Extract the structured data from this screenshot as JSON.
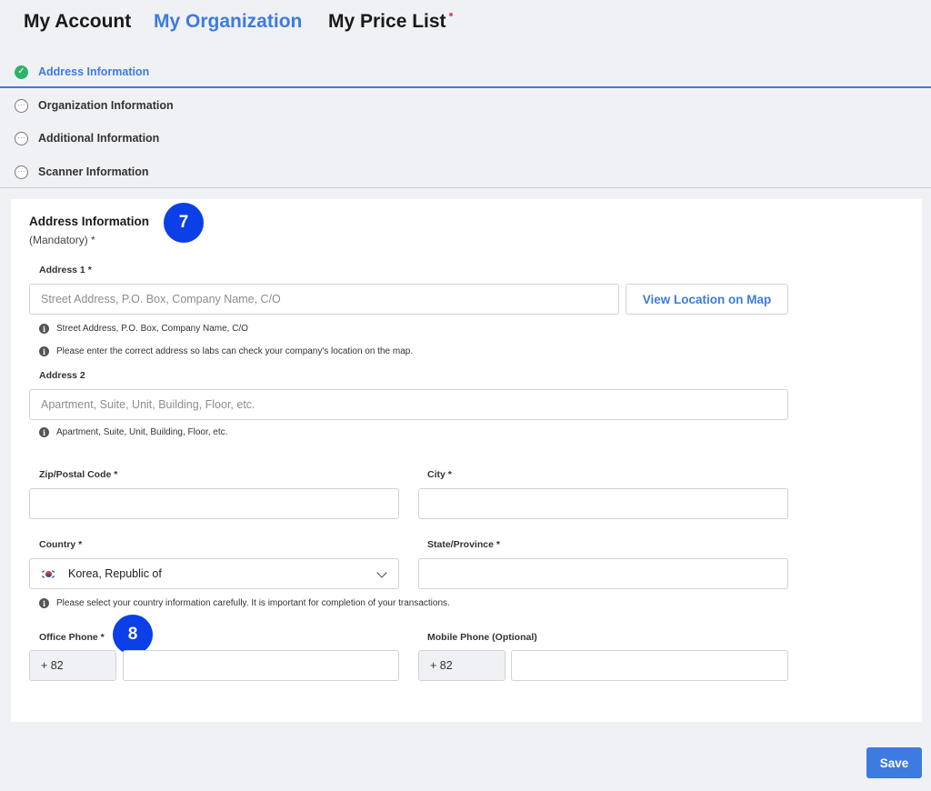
{
  "top_tabs": {
    "my_account": "My Account",
    "my_organization": "My Organization",
    "my_price_list": "My Price List"
  },
  "steps": [
    {
      "label": "Address Information",
      "status": "done",
      "icon": "check-icon"
    },
    {
      "label": "Organization Information",
      "status": "pending",
      "icon": "ellipsis-icon"
    },
    {
      "label": "Additional Information",
      "status": "pending",
      "icon": "ellipsis-icon"
    },
    {
      "label": "Scanner Information",
      "status": "pending",
      "icon": "ellipsis-icon"
    }
  ],
  "section": {
    "title": "Address Information",
    "subtitle": "(Mandatory) *"
  },
  "badges": {
    "first": "7",
    "second": "8"
  },
  "address1": {
    "label": "Address 1 *",
    "placeholder": "Street Address, P.O. Box, Company Name, C/O",
    "value": "",
    "map_button": "View Location on Map",
    "hint1": "Street Address, P.O. Box, Company Name, C/O",
    "hint2": "Please enter the correct address so labs can check your company's location on the map."
  },
  "address2": {
    "label": "Address 2",
    "placeholder": "Apartment, Suite, Unit, Building, Floor, etc.",
    "value": "",
    "hint": "Apartment, Suite, Unit, Building, Floor, etc."
  },
  "zip": {
    "label": "Zip/Postal Code *",
    "value": ""
  },
  "city": {
    "label": "City *",
    "value": ""
  },
  "country": {
    "label": "Country *",
    "selected": "Korea, Republic of",
    "flag": "south-korea-flag",
    "hint": "Please select your country information carefully. It is important for completion of your transactions."
  },
  "state": {
    "label": "State/Province *",
    "value": ""
  },
  "office_phone": {
    "label": "Office Phone *",
    "prefix": "+ 82",
    "value": ""
  },
  "mobile_phone": {
    "label": "Mobile Phone (Optional)",
    "prefix": "+ 82",
    "value": ""
  },
  "save_button": "Save",
  "colors": {
    "accent": "#3d7be0",
    "badge": "#0b3fe8",
    "done": "#2fb26a",
    "notification_dot": "#e64b7a"
  }
}
